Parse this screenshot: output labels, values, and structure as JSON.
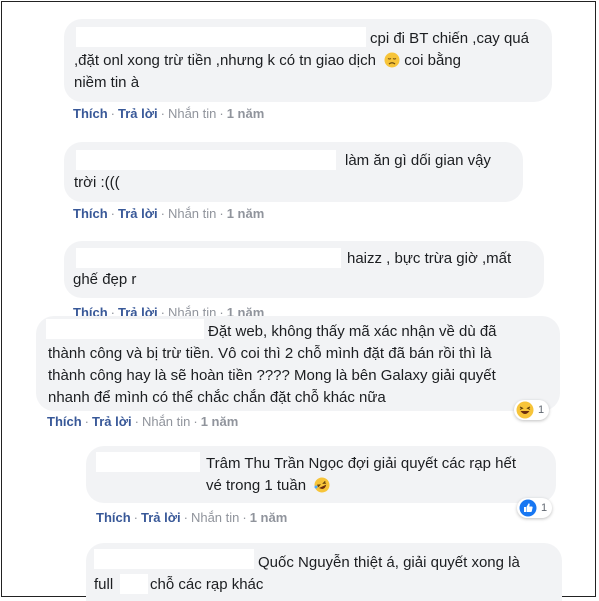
{
  "actions": {
    "like": "Thích",
    "reply": "Trả lời",
    "message": "Nhắn tin",
    "separator": "·"
  },
  "comments": [
    {
      "lines": [
        "cpi đi BT chiến ,cay quá",
        ",đặt onl xong trừ tiền ,nhưng k có tn giao dịch",
        "niềm tin à"
      ],
      "inline_after_line2": "coi bằng",
      "emoji": "disappointed-face",
      "time": "1 năm"
    },
    {
      "lines": [
        "làm ăn gì dối gian vậy",
        "trời :((("
      ],
      "time": "1 năm"
    },
    {
      "lines": [
        "haizz , bực trừa giờ ,mất",
        "ghế đẹp r"
      ],
      "time": "1 năm"
    },
    {
      "lines": [
        "Đặt web, không thấy mã xác nhận về dù đã",
        "thành công và bị trừ tiền. Vô coi thì 2 chỗ mình đặt đã bán rồi thì là",
        "thành công hay là sẽ hoàn tiền ???? Mong là bên Galaxy giải quyết",
        "nhanh để mình có thể chắc chắn đặt chỗ khác nữa"
      ],
      "time": "1 năm",
      "reaction": {
        "type": "haha",
        "count": "1"
      }
    },
    {
      "lines": [
        "Trâm Thu Trần Ngọc đợi giải quyết các rạp hết",
        "vé trong 1 tuần"
      ],
      "emoji": "rofl-face",
      "time": "1 năm",
      "reaction": {
        "type": "like",
        "count": "1"
      }
    },
    {
      "lines": [
        "Quốc Nguyễn thiệt á, giải quyết xong là",
        "full",
        "chỗ các rạp khác"
      ]
    }
  ]
}
